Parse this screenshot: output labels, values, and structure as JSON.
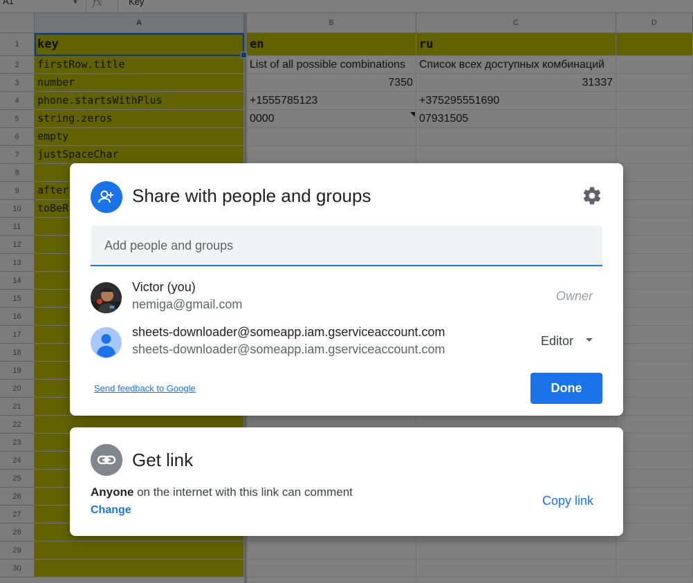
{
  "formula_bar": {
    "name_box": "A1",
    "fx": "fx",
    "value": "Key"
  },
  "sheet": {
    "columns": [
      "A",
      "B",
      "C",
      "D"
    ],
    "rows": [
      "1",
      "2",
      "3",
      "4",
      "5",
      "6",
      "7",
      "8",
      "9",
      "10",
      "11",
      "12",
      "13",
      "14",
      "15",
      "16",
      "17",
      "18",
      "19",
      "20",
      "21",
      "22",
      "23",
      "24",
      "25",
      "26",
      "27",
      "28",
      "29",
      "30"
    ],
    "header_row": {
      "a": "key",
      "b": "en",
      "c": "ru"
    },
    "data": [
      {
        "a": "firstRow.title",
        "b": "List of all possible combinations",
        "c": "Список всех доступных комбинаций"
      },
      {
        "a": "number",
        "b": "7350",
        "c": "31337"
      },
      {
        "a": "phone.startsWithPlus",
        "b": "+1555785123",
        "c": "+375295551690"
      },
      {
        "a": "string.zeros",
        "b": "0000",
        "c": "07931505"
      },
      {
        "a": "empty",
        "b": "",
        "c": ""
      },
      {
        "a": "justSpaceChar",
        "b": "",
        "c": ""
      },
      {
        "a": "",
        "b": "",
        "c": ""
      },
      {
        "a": "after",
        "b": "",
        "c": ""
      },
      {
        "a": "toBeR",
        "b": "",
        "c": ""
      }
    ],
    "highlight_color": "#c4c400"
  },
  "share_dialog": {
    "title": "Share with people and groups",
    "add_placeholder": "Add people and groups",
    "people": [
      {
        "name": "Victor (you)",
        "email": "nemiga@gmail.com",
        "role": "Owner"
      },
      {
        "name": "sheets-downloader@someapp.iam.gserviceaccount.com",
        "email": "sheets-downloader@someapp.iam.gserviceaccount.com",
        "role": "Editor"
      }
    ],
    "feedback_link": "Send feedback to Google",
    "done_label": "Done",
    "accent": "#1a73e8"
  },
  "link_dialog": {
    "title": "Get link",
    "scope_bold": "Anyone",
    "scope_rest": " on the internet with this link can comment",
    "change_label": "Change",
    "copy_label": "Copy link"
  }
}
